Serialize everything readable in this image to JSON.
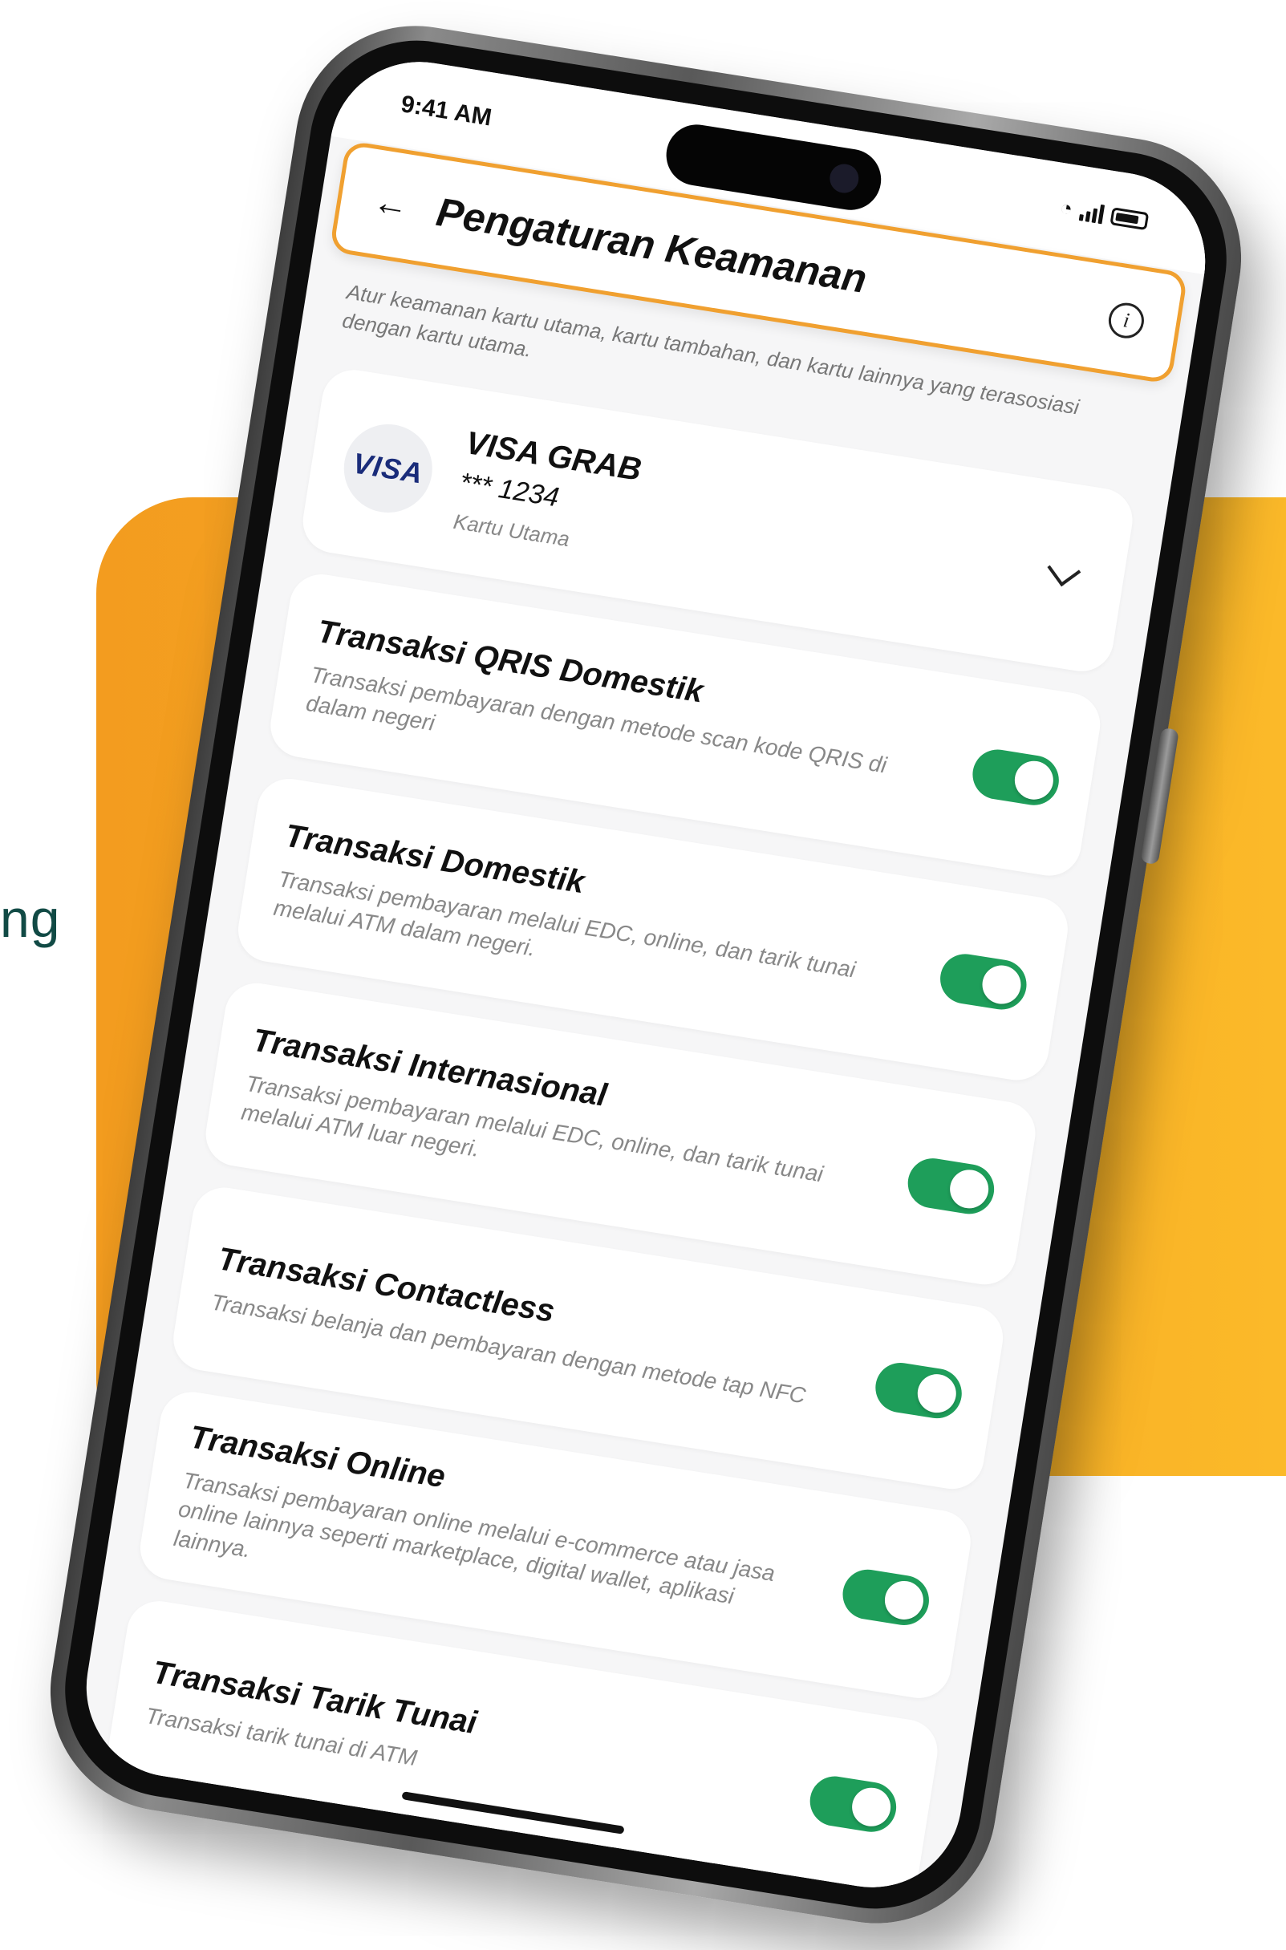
{
  "side_text": "ng",
  "status_bar": {
    "time": "9:41 AM"
  },
  "header": {
    "title": "Pengaturan Keamanan"
  },
  "description": "Atur keamanan kartu utama, kartu tambahan, dan kartu lainnya yang terasosiasi dengan kartu utama.",
  "account": {
    "logo": "VISA",
    "name": "VISA GRAB",
    "number": "*** 1234",
    "type": "Kartu Utama"
  },
  "settings": [
    {
      "title": "Transaksi QRIS Domestik",
      "desc": "Transaksi pembayaran dengan metode scan kode QRIS di dalam negeri"
    },
    {
      "title": "Transaksi Domestik",
      "desc": "Transaksi pembayaran melalui EDC, online, dan tarik tunai melalui ATM dalam negeri."
    },
    {
      "title": "Transaksi Internasional",
      "desc": "Transaksi pembayaran melalui EDC, online, dan tarik tunai melalui ATM luar negeri."
    },
    {
      "title": "Transaksi Contactless",
      "desc": "Transaksi belanja dan pembayaran dengan metode tap NFC"
    },
    {
      "title": "Transaksi Online",
      "desc": "Transaksi pembayaran online melalui e-commerce atau jasa online lainnya seperti marketplace, digital wallet, aplikasi lainnya."
    },
    {
      "title": "Transaksi Tarik Tunai",
      "desc": "Transaksi tarik tunai di ATM"
    }
  ],
  "colors": {
    "accent": "#f0a030",
    "toggle_on": "#1e9e5a",
    "text_teal": "#114a45"
  },
  "icons": {
    "back": "back-arrow-icon",
    "info": "info-icon",
    "chevron": "chevron-down-icon"
  }
}
